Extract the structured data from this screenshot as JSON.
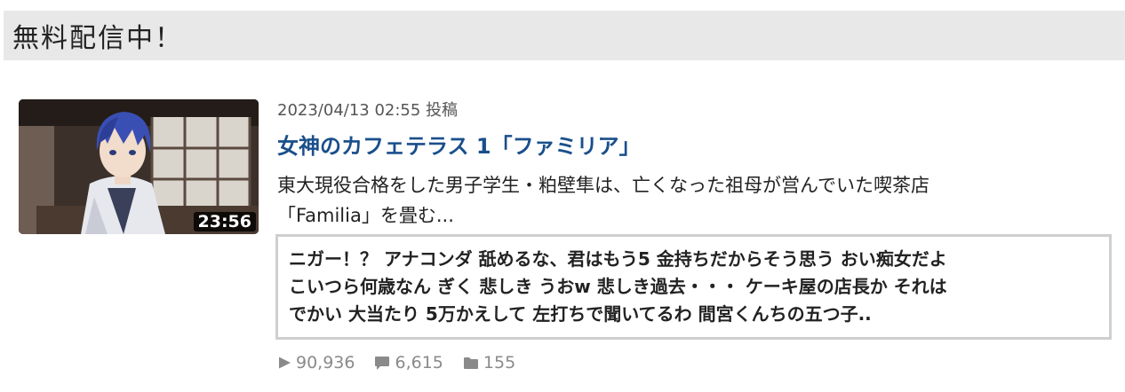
{
  "section": {
    "title": "無料配信中！"
  },
  "video": {
    "duration": "23:56",
    "date": "2023/04/13 02:55 投稿",
    "title": "女神のカフェテラス 1「ファミリア」",
    "description_line1": "東大現役合格をした男子学生・粕壁隼は、亡くなった祖母が営んでいた喫茶店",
    "description_line2": "「Familia」を畳む...",
    "comments_line1": "ニガー！？ アナコンダ 舐めるな、君はもう5 金持ちだからそう思う おい痴女だよ",
    "comments_line2": "こいつら何歳なん ぎく 悲しき うおw 悲しき過去・・・ ケーキ屋の店長か それは",
    "comments_line3": "でかい 大当たり 5万かえして 左打ちで聞いてるわ 間宮くんちの五つ子..",
    "stats": {
      "views": "90,936",
      "comments": "6,615",
      "mylists": "155"
    },
    "icons": {
      "views": "play-icon",
      "comments": "comment-bubble-icon",
      "mylists": "folder-icon"
    }
  },
  "colors": {
    "title": "#1a4f8b",
    "header_bg": "#e8e8e8",
    "stats": "#8a8a8a"
  }
}
